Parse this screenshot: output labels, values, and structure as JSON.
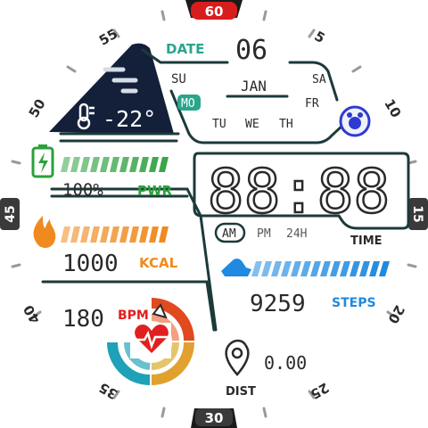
{
  "bezel": {
    "marker_60": "60",
    "marker_5": "5",
    "marker_10": "10",
    "marker_15": "15",
    "marker_20": "20",
    "marker_25": "25",
    "marker_30": "30",
    "marker_35": "35",
    "marker_40": "40",
    "marker_45": "45",
    "marker_50": "50",
    "marker_55": "55"
  },
  "weather": {
    "temperature": "-22°",
    "icon": "fog-icon"
  },
  "date": {
    "label": "DATE",
    "day": "06",
    "month": "JAN",
    "weekdays": [
      "SU",
      "MO",
      "TU",
      "WE",
      "TH",
      "FR",
      "SA"
    ],
    "active_weekday": "MO"
  },
  "alarm": {
    "icon": "alarm-clock-icon"
  },
  "battery": {
    "value": "100%",
    "label": "PWR",
    "level": 1.0,
    "color": "#3aa64a"
  },
  "calories": {
    "value": "1000",
    "label": "KCAL",
    "level": 1.0,
    "color": "#f08a1e"
  },
  "heart": {
    "value": "180",
    "label": "BPM",
    "color": "#e0201f"
  },
  "time": {
    "display": "88:88",
    "am": "AM",
    "pm": "PM",
    "h24": "24H",
    "label": "TIME",
    "active_mode": "AM"
  },
  "steps": {
    "value": "9259",
    "label": "STEPS",
    "level": 1.0,
    "color": "#1f8ae0"
  },
  "distance": {
    "value": "0.00",
    "label": "DIST"
  },
  "colors": {
    "accent_teal": "#2aa58c",
    "dark_navy": "#14203a",
    "frame": "#1c3a3a"
  }
}
